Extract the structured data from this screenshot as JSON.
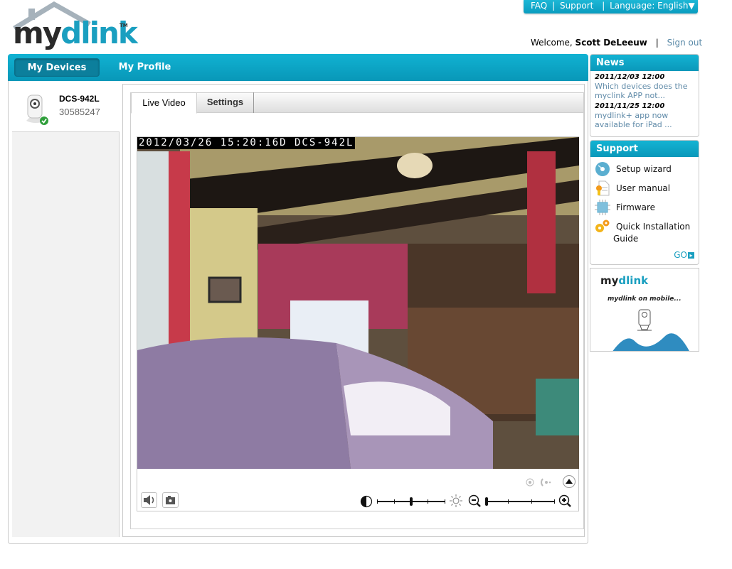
{
  "top_links": {
    "faq": "FAQ",
    "support": "Support",
    "language": "Language: English",
    "separator": "|",
    "dropdown_glyph": "▼"
  },
  "logo": {
    "my": "my",
    "dlink": "dlink",
    "tm": "TM"
  },
  "welcome": {
    "prefix": "Welcome,",
    "user": "Scott DeLeeuw",
    "separator": "|",
    "signout": "Sign out"
  },
  "nav": {
    "items": [
      {
        "label": "My Devices",
        "active": true
      },
      {
        "label": "My Profile",
        "active": false
      }
    ]
  },
  "device": {
    "name": "DCS-942L",
    "serial": "30585247",
    "status": "online",
    "status_color": "#2e9e3a"
  },
  "tabs": [
    {
      "label": "Live Video",
      "active": true
    },
    {
      "label": "Settings",
      "active": false
    }
  ],
  "video": {
    "osd_text": "2012/03/26 15:20:16D DCS-942L"
  },
  "controls": {
    "audio_icon": "speaker-icon",
    "snapshot_icon": "camera-icon",
    "brightness_level": 0.5,
    "zoom_level": 0.0,
    "brightness_ticks": 4,
    "zoom_ticks": 3
  },
  "news": {
    "title": "News",
    "items": [
      {
        "date": "2011/12/03 12:00",
        "text": "Which devices does the myclink APP not..."
      },
      {
        "date": "2011/11/25 12:00",
        "text": "mydlink+ app now available for iPad ..."
      }
    ]
  },
  "support": {
    "title": "Support",
    "items": [
      {
        "label": "Setup wizard",
        "icon": "disc-icon"
      },
      {
        "label": "User manual",
        "icon": "document-icon"
      },
      {
        "label": "Firmware",
        "icon": "chip-icon"
      },
      {
        "label": "Quick Installation",
        "label2": "Guide",
        "icon": "gears-icon"
      }
    ],
    "go_label": "GO"
  },
  "promo": {
    "logo_my": "my",
    "logo_dlink": "dlink",
    "tagline": "mydlink on mobile..."
  },
  "colors": {
    "accent": "#0fa8c9",
    "nav_active": "#0c7f9c",
    "link": "#5f8aa8"
  }
}
